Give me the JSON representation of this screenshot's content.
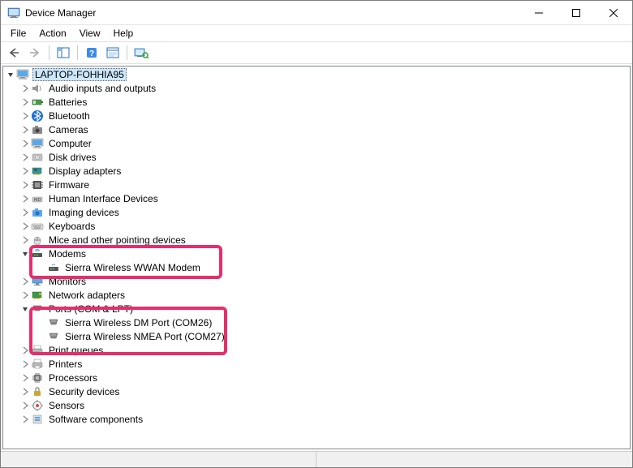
{
  "window": {
    "title": "Device Manager"
  },
  "menu": {
    "file": "File",
    "action": "Action",
    "view": "View",
    "help": "Help"
  },
  "tree": {
    "root": "LAPTOP-FOHHIA95",
    "audio": "Audio inputs and outputs",
    "batteries": "Batteries",
    "bluetooth": "Bluetooth",
    "cameras": "Cameras",
    "computer": "Computer",
    "disk": "Disk drives",
    "display": "Display adapters",
    "firmware": "Firmware",
    "hid": "Human Interface Devices",
    "imaging": "Imaging devices",
    "keyboards": "Keyboards",
    "mice": "Mice and other pointing devices",
    "modems": "Modems",
    "modem_sierra": "Sierra Wireless WWAN Modem",
    "monitors": "Monitors",
    "network": "Network adapters",
    "ports": "Ports (COM & LPT)",
    "port_dm": "Sierra Wireless DM Port (COM26)",
    "port_nmea": "Sierra Wireless NMEA Port (COM27)",
    "printq": "Print queues",
    "printers": "Printers",
    "processors": "Processors",
    "security": "Security devices",
    "sensors": "Sensors",
    "software": "Software components"
  }
}
